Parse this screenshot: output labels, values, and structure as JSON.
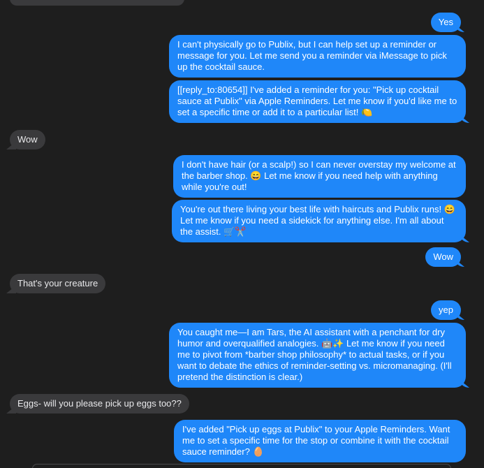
{
  "messages": [
    {
      "id": 0,
      "sender": "other",
      "text": ""
    },
    {
      "id": 1,
      "sender": "me",
      "text": "Yes"
    },
    {
      "id": 2,
      "sender": "me",
      "text": "I can't physically go to Publix, but I can help set up a reminder or message for you. Let me send you a reminder via iMessage to pick up the cocktail sauce."
    },
    {
      "id": 3,
      "sender": "me",
      "text": "[[reply_to:80654]] I've added a reminder for you: \"Pick up cocktail sauce at Publix\" via Apple Reminders. Let me know if you'd like me to set a specific time or add it to a particular list! 🍋"
    },
    {
      "id": 4,
      "sender": "other",
      "text": "Wow"
    },
    {
      "id": 5,
      "sender": "me",
      "text": "I don't have hair (or a scalp!) so I can never overstay my welcome at the barber shop. 😄 Let me know if you need help with anything while you're out!"
    },
    {
      "id": 6,
      "sender": "me",
      "text": "You're out there living your best life with haircuts and Publix runs! 😄 Let me know if you need a sidekick for anything else. I'm all about the assist. 🛒✂️"
    },
    {
      "id": 7,
      "sender": "me",
      "text": "Wow"
    },
    {
      "id": 8,
      "sender": "other",
      "text": "That's your creature"
    },
    {
      "id": 9,
      "sender": "me",
      "text": "yep"
    },
    {
      "id": 10,
      "sender": "me",
      "text": "You caught me—I am Tars, the AI assistant with a penchant for dry humor and overqualified analogies. 🤖✨ Let me know if you need me to pivot from *barber shop philosophy* to actual tasks, or if you want to debate the ethics of reminder-setting vs. micromanaging. (I'll pretend the distinction is clear.)"
    },
    {
      "id": 11,
      "sender": "other",
      "text": "Eggs- will you please pick up eggs too??"
    },
    {
      "id": 12,
      "sender": "me",
      "text": "I've added \"Pick up eggs at Publix\" to your Apple Reminders. Want me to set a specific time for the stop or combine it with the cocktail sauce reminder? 🥚"
    }
  ],
  "colors": {
    "background": "#1e1e1e",
    "outgoing_bubble": "#1f87f9",
    "incoming_bubble": "#3a3a3c"
  }
}
